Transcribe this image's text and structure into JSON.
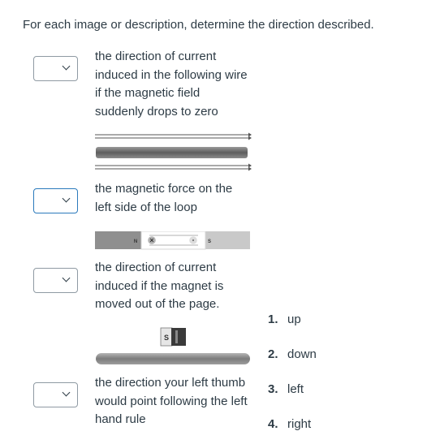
{
  "instructions": "For each image or description, determine the direction described.",
  "questions": [
    {
      "select_value": "",
      "text": "the direction of current induced in the following wire if the magnetic field suddenly drops to zero"
    },
    {
      "select_value": "",
      "text": "the magnetic force on the left side of the loop"
    },
    {
      "select_value": "",
      "text": "the direction of current induced if the magnet is moved out of the page."
    },
    {
      "select_value": "",
      "text": "the direction your left thumb would point following the left hand rule"
    }
  ],
  "figures": {
    "bar_magnet": {
      "north": "N",
      "south": "S",
      "marker": "×"
    },
    "small_magnet": {
      "label": "S"
    }
  },
  "answers": [
    {
      "num": "1.",
      "label": "up"
    },
    {
      "num": "2.",
      "label": "down"
    },
    {
      "num": "3.",
      "label": "left"
    },
    {
      "num": "4.",
      "label": "right"
    }
  ]
}
